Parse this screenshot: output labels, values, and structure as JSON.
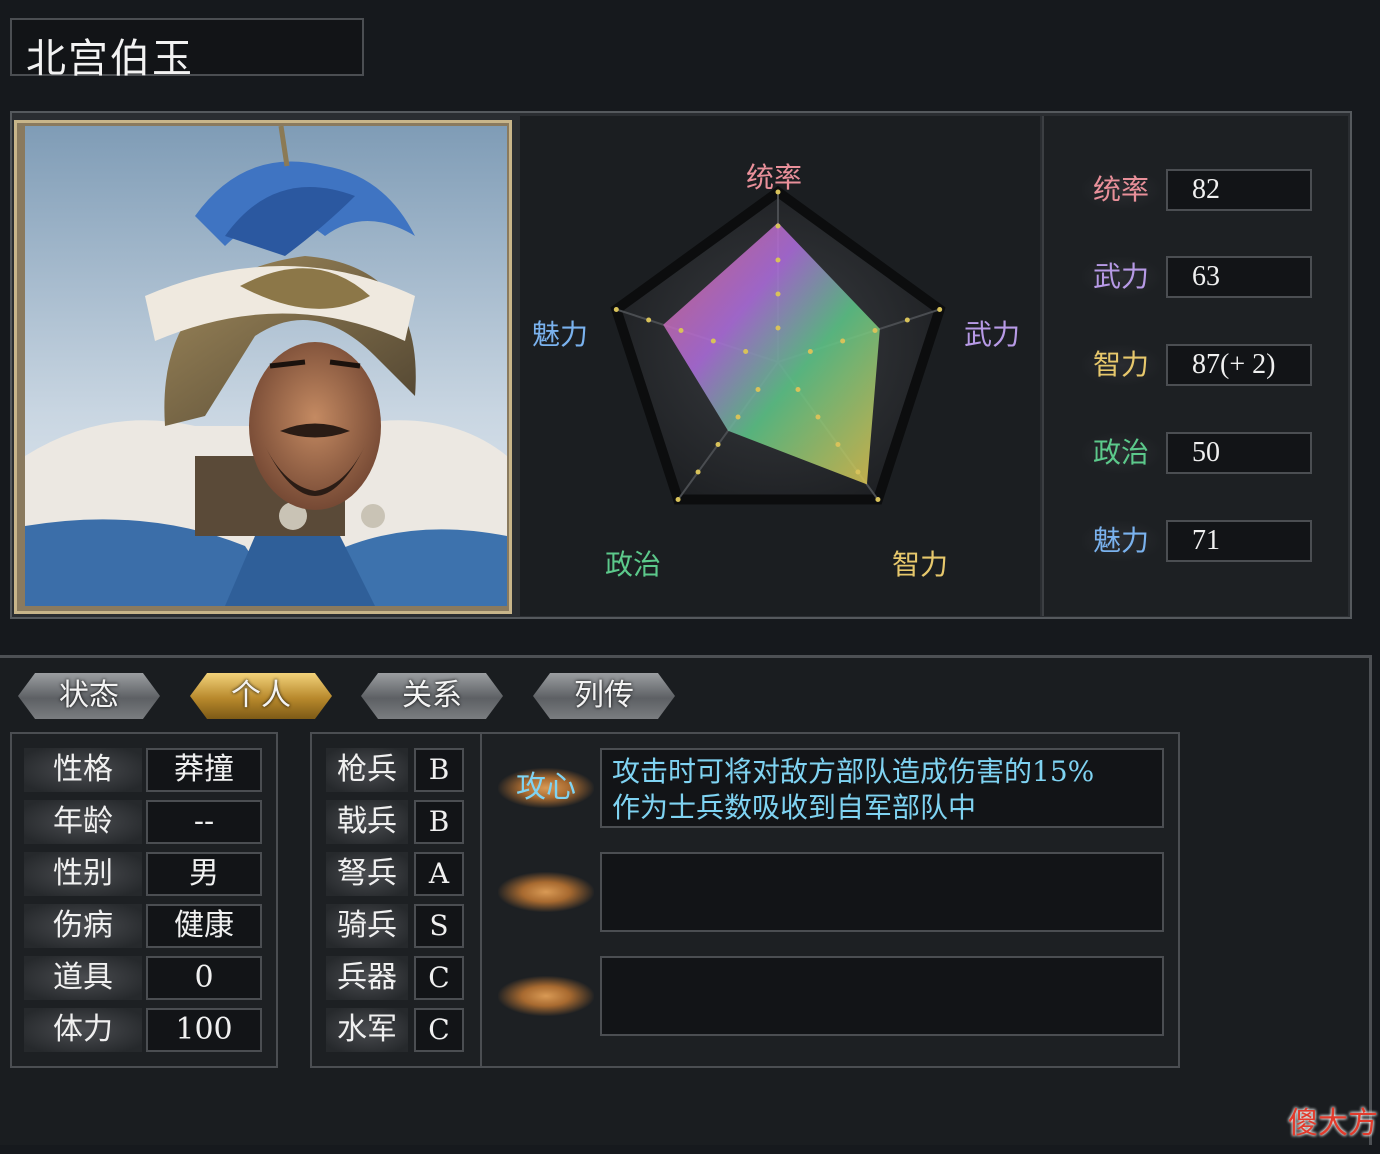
{
  "officer": {
    "name": "北宫伯玉"
  },
  "colors": {
    "command": "#e9909a",
    "strength": "#b79ae6",
    "intelligence": "#e7c86c",
    "politics": "#5cc98b",
    "charm": "#7ab2ee",
    "skill_text": "#7fd3f2",
    "active_tab": "#d9a83e"
  },
  "radar": {
    "labels": [
      "统率",
      "武力",
      "智力",
      "政治",
      "魅力"
    ],
    "max": 100
  },
  "stats": [
    {
      "label": "统率",
      "value": "82",
      "base": 82
    },
    {
      "label": "武力",
      "value": "63",
      "base": 63
    },
    {
      "label": "智力",
      "value": "87(+ 2)",
      "base": 89
    },
    {
      "label": "政治",
      "value": "50",
      "base": 50
    },
    {
      "label": "魅力",
      "value": "71",
      "base": 71
    }
  ],
  "tabs": [
    {
      "label": "状态",
      "active": false
    },
    {
      "label": "个人",
      "active": true
    },
    {
      "label": "关系",
      "active": false
    },
    {
      "label": "列传",
      "active": false
    }
  ],
  "personal": [
    {
      "label": "性格",
      "value": "莽撞"
    },
    {
      "label": "年龄",
      "value": "--"
    },
    {
      "label": "性别",
      "value": "男"
    },
    {
      "label": "伤病",
      "value": "健康"
    },
    {
      "label": "道具",
      "value": "0"
    },
    {
      "label": "体力",
      "value": "100"
    }
  ],
  "troops": [
    {
      "label": "枪兵",
      "value": "B"
    },
    {
      "label": "戟兵",
      "value": "B"
    },
    {
      "label": "弩兵",
      "value": "A"
    },
    {
      "label": "骑兵",
      "value": "S"
    },
    {
      "label": "兵器",
      "value": "C"
    },
    {
      "label": "水军",
      "value": "C"
    }
  ],
  "skills": [
    {
      "name": "攻心",
      "desc_line1": "攻击时可将对敌方部队造成伤害的15%",
      "desc_line2": "作为士兵数吸收到自军部队中"
    },
    {
      "name": "",
      "desc_line1": "",
      "desc_line2": ""
    },
    {
      "name": "",
      "desc_line1": "",
      "desc_line2": ""
    }
  ],
  "watermark": "傻大方"
}
